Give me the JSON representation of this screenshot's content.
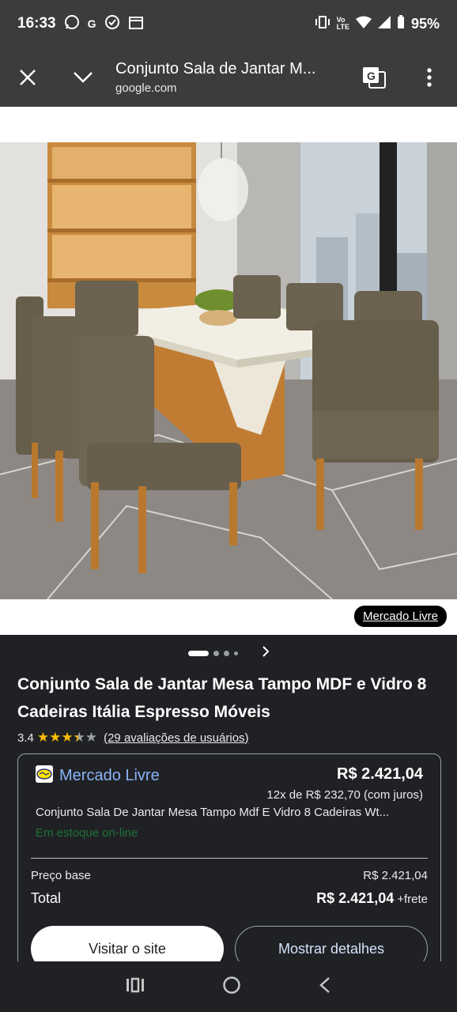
{
  "status_bar": {
    "time": "16:33",
    "battery": "95%",
    "icons": [
      "whatsapp-icon",
      "g-icon",
      "check-circle-icon",
      "calendar-icon",
      "vibrate-icon",
      "volte-icon",
      "wifi-icon",
      "signal-icon",
      "battery-icon"
    ]
  },
  "toolbar": {
    "title": "Conjunto Sala de Jantar M...",
    "url": "google.com"
  },
  "media": {
    "source_label": "Mercado Livre"
  },
  "product": {
    "title": "Conjunto Sala de Jantar Mesa Tampo MDF e Vidro 8 Cadeiras Itália Espresso Móveis",
    "rating_value": "3.4",
    "rating_stars": 3.4,
    "reviews_text": "(29 avaliações de usuários)"
  },
  "offer": {
    "merchant": "Mercado Livre",
    "price": "R$ 2.421,04",
    "installments": "12x de R$ 232,70 (com juros)",
    "description": "Conjunto Sala De Jantar Mesa Tampo Mdf E Vidro 8 Cadeiras Wt...",
    "stock": "Em estoque on-line",
    "base_price_label": "Preço base",
    "base_price": "R$ 2.421,04",
    "total_label": "Total",
    "total": "R$ 2.421,04",
    "shipping": "+frete",
    "visit_button": "Visitar o site",
    "details_button": "Mostrar detalhes"
  },
  "colors": {
    "bar_bg": "#3c3c3c",
    "page_bg": "#202124",
    "link": "#8ab4f8",
    "star": "#fbbc04",
    "stock_green": "#1e8e3e"
  }
}
